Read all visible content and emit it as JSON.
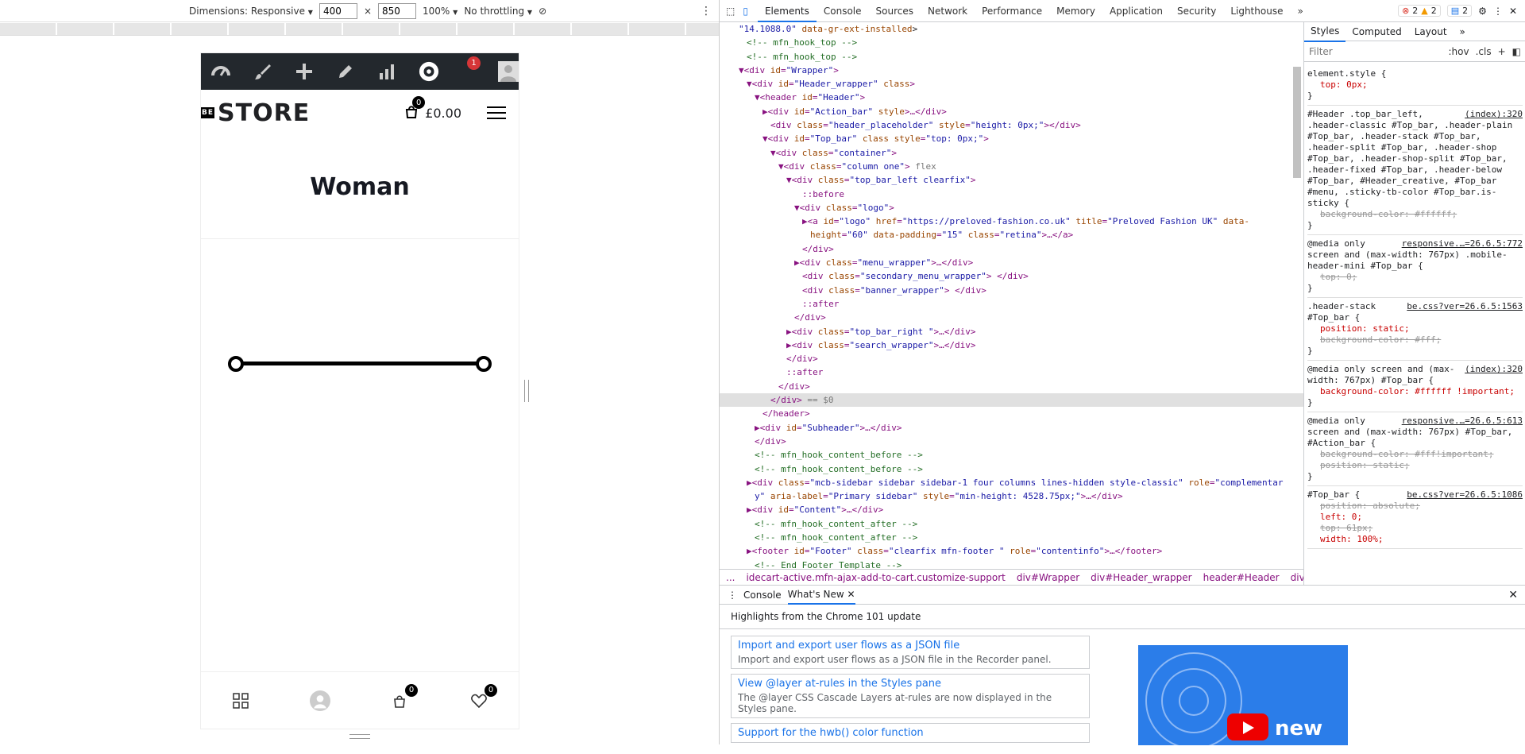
{
  "device_toolbar": {
    "dimensions_label": "Dimensions: Responsive",
    "width": "400",
    "times": "×",
    "height": "850",
    "zoom": "100%",
    "throttling": "No throttling"
  },
  "site": {
    "admin_badge": "1",
    "logo_be": "BE",
    "logo_text": "STORE",
    "cart_count": "0",
    "cart_total": "£0.00",
    "page_title": "Woman",
    "bottom_cart_count": "0",
    "bottom_wishlist_count": "0"
  },
  "devtools": {
    "tabs": [
      "Elements",
      "Console",
      "Sources",
      "Network",
      "Performance",
      "Memory",
      "Application",
      "Security",
      "Lighthouse"
    ],
    "more_tabs": "»",
    "errors": "2",
    "warnings": "2",
    "messages": "2",
    "dom_lines": [
      {
        "indent": 2,
        "html": "<span class='av'>\"14.1088.0\"</span> <span class='at'>data-gr-ext-installed</span><span class='tx'>&gt;</span>"
      },
      {
        "indent": 3,
        "html": "<span class='cm'>&lt;!-- mfn_hook_top --&gt;</span>"
      },
      {
        "indent": 3,
        "html": "<span class='cm'>&lt;!-- mfn_hook_top --&gt;</span>"
      },
      {
        "indent": 2,
        "html": "▼&lt;div <span class='at'>id</span>=<span class='av'>\"Wrapper\"</span>&gt;"
      },
      {
        "indent": 3,
        "html": "▼&lt;div <span class='at'>id</span>=<span class='av'>\"Header_wrapper\"</span> <span class='at'>class</span>&gt;"
      },
      {
        "indent": 4,
        "html": "▼&lt;header <span class='at'>id</span>=<span class='av'>\"Header\"</span>&gt;"
      },
      {
        "indent": 5,
        "html": "▶&lt;div <span class='at'>id</span>=<span class='av'>\"Action_bar\"</span> <span class='at'>style</span>&gt;…&lt;/div&gt;"
      },
      {
        "indent": 6,
        "html": "&lt;div <span class='at'>class</span>=<span class='av'>\"header_placeholder\"</span> <span class='at'>style</span>=<span class='av'>\"height: 0px;\"</span>&gt;&lt;/div&gt;"
      },
      {
        "indent": 5,
        "html": "▼&lt;div <span class='at'>id</span>=<span class='av'>\"Top_bar\"</span> <span class='at'>class</span> <span class='at'>style</span>=<span class='av'>\"top: 0px;\"</span>&gt;"
      },
      {
        "indent": 6,
        "html": "▼&lt;div <span class='at'>class</span>=<span class='av'>\"container\"</span>&gt;"
      },
      {
        "indent": 7,
        "html": "▼&lt;div <span class='at'>class</span>=<span class='av'>\"column one\"</span>&gt; <span class='gy'>flex</span>"
      },
      {
        "indent": 8,
        "html": "▼&lt;div <span class='at'>class</span>=<span class='av'>\"top_bar_left clearfix\"</span>&gt;"
      },
      {
        "indent": 10,
        "html": "::before"
      },
      {
        "indent": 9,
        "html": "▼&lt;div <span class='at'>class</span>=<span class='av'>\"logo\"</span>&gt;"
      },
      {
        "indent": 10,
        "html": "▶&lt;a <span class='at'>id</span>=<span class='av'>\"logo\"</span> <span class='at'>href</span>=<span class='av'>\"https://preloved-fashion.co.uk\"</span> <span class='at'>title</span>=<span class='av'>\"Preloved Fashion UK\"</span> <span class='at'>data-</span>"
      },
      {
        "indent": 11,
        "html": "<span class='at'>height</span>=<span class='av'>\"60\"</span> <span class='at'>data-padding</span>=<span class='av'>\"15\"</span> <span class='at'>class</span>=<span class='av'>\"retina\"</span>&gt;…&lt;/a&gt;"
      },
      {
        "indent": 10,
        "html": "&lt;/div&gt;"
      },
      {
        "indent": 9,
        "html": "▶&lt;div <span class='at'>class</span>=<span class='av'>\"menu_wrapper\"</span>&gt;…&lt;/div&gt;"
      },
      {
        "indent": 10,
        "html": "&lt;div <span class='at'>class</span>=<span class='av'>\"secondary_menu_wrapper\"</span>&gt; &lt;/div&gt;"
      },
      {
        "indent": 10,
        "html": "&lt;div <span class='at'>class</span>=<span class='av'>\"banner_wrapper\"</span>&gt; &lt;/div&gt;"
      },
      {
        "indent": 10,
        "html": "::after"
      },
      {
        "indent": 9,
        "html": "&lt;/div&gt;"
      },
      {
        "indent": 8,
        "html": "▶&lt;div <span class='at'>class</span>=<span class='av'>\"top_bar_right \"</span>&gt;…&lt;/div&gt;"
      },
      {
        "indent": 8,
        "html": "▶&lt;div <span class='at'>class</span>=<span class='av'>\"search_wrapper\"</span>&gt;…&lt;/div&gt;"
      },
      {
        "indent": 8,
        "html": "&lt;/div&gt;"
      },
      {
        "indent": 8,
        "html": "::after"
      },
      {
        "indent": 7,
        "html": "&lt;/div&gt;"
      },
      {
        "indent": 6,
        "html": "&lt;/div&gt; <span class='gy'>== $0</span>",
        "selected": true
      },
      {
        "indent": 5,
        "html": "&lt;/header&gt;"
      },
      {
        "indent": 4,
        "html": "▶&lt;div <span class='at'>id</span>=<span class='av'>\"Subheader\"</span>&gt;…&lt;/div&gt;"
      },
      {
        "indent": 4,
        "html": "&lt;/div&gt;"
      },
      {
        "indent": 4,
        "html": "<span class='cm'>&lt;!-- mfn_hook_content_before --&gt;</span>"
      },
      {
        "indent": 4,
        "html": "<span class='cm'>&lt;!-- mfn_hook_content_before --&gt;</span>"
      },
      {
        "indent": 3,
        "html": "▶&lt;div <span class='at'>class</span>=<span class='av'>\"mcb-sidebar sidebar sidebar-1 four columns lines-hidden style-classic\"</span> <span class='at'>role</span>=<span class='av'>\"complementar</span>"
      },
      {
        "indent": 4,
        "html": "<span class='av'>y\"</span> <span class='at'>aria-label</span>=<span class='av'>\"Primary sidebar\"</span> <span class='at'>style</span>=<span class='av'>\"min-height: 4528.75px;\"</span>&gt;…&lt;/div&gt;"
      },
      {
        "indent": 3,
        "html": "▶&lt;div <span class='at'>id</span>=<span class='av'>\"Content\"</span>&gt;…&lt;/div&gt;"
      },
      {
        "indent": 4,
        "html": "<span class='cm'>&lt;!-- mfn_hook_content_after --&gt;</span>"
      },
      {
        "indent": 4,
        "html": "<span class='cm'>&lt;!-- mfn_hook_content_after --&gt;</span>"
      },
      {
        "indent": 3,
        "html": "▶&lt;footer <span class='at'>id</span>=<span class='av'>\"Footer\"</span> <span class='at'>class</span>=<span class='av'>\"clearfix mfn-footer \"</span> <span class='at'>role</span>=<span class='av'>\"contentinfo\"</span>&gt;…&lt;/footer&gt;"
      },
      {
        "indent": 4,
        "html": "<span class='cm'>&lt;!-- End Footer Template --&gt;</span>"
      }
    ],
    "breadcrumbs": [
      "...",
      "idecart-active.mfn-ajax-add-to-cart.customize-support",
      "div#Wrapper",
      "div#Header_wrapper",
      "header#Header",
      "div#Top_bar",
      "..."
    ],
    "styles_tabs": [
      "Styles",
      "Computed",
      "Layout",
      "»"
    ],
    "filter_placeholder": "Filter",
    "hov": ":hov",
    "cls": ".cls",
    "rules": [
      {
        "selector": "element.style {",
        "source": "",
        "props": [
          {
            "t": "top: 0px;",
            "strike": false
          }
        ],
        "close": "}"
      },
      {
        "selector": "#Header .top_bar_left, .header-classic #Top_bar, .header-plain #Top_bar, .header-stack #Top_bar, .header-split #Top_bar, .header-shop #Top_bar, .header-shop-split #Top_bar, .header-fixed #Top_bar, .header-below #Top_bar, #Header_creative, #Top_bar #menu, .sticky-tb-color #Top_bar.is-sticky {",
        "source": "(index):320",
        "props": [
          {
            "t": "background-color: #ffffff;",
            "strike": true
          }
        ],
        "close": "}"
      },
      {
        "selector": "@media only screen and (max-width: 767px) .mobile-header-mini #Top_bar {",
        "source": "responsive.…=26.6.5:772",
        "props": [
          {
            "t": "top: 0;",
            "strike": true
          }
        ],
        "close": "}"
      },
      {
        "selector": ".header-stack #Top_bar {",
        "source": "be.css?ver=26.6.5:1563",
        "props": [
          {
            "t": "position: static;",
            "strike": false
          },
          {
            "t": "background-color: #fff;",
            "strike": true
          }
        ],
        "close": "}"
      },
      {
        "selector": "@media only screen and (max-width: 767px) #Top_bar {",
        "source": "(index):320",
        "props": [
          {
            "t": "background-color: #ffffff !important;",
            "strike": false
          }
        ],
        "close": "}"
      },
      {
        "selector": "@media only screen and (max-width: 767px) #Top_bar, #Action_bar {",
        "source": "responsive.…=26.6.5:613",
        "props": [
          {
            "t": "background-color: #fff!important;",
            "strike": true
          },
          {
            "t": "position: static;",
            "strike": true
          }
        ],
        "close": "}"
      },
      {
        "selector": "#Top_bar {",
        "source": "be.css?ver=26.6.5:1086",
        "props": [
          {
            "t": "position: absolute;",
            "strike": true
          },
          {
            "t": "left: 0;",
            "strike": false
          },
          {
            "t": "top: 61px;",
            "strike": true
          },
          {
            "t": "width: 100%;",
            "strike": false
          }
        ],
        "close": ""
      }
    ],
    "drawer_tabs": [
      "Console",
      "What's New"
    ],
    "highlights": "Highlights from the Chrome 101 update",
    "cards": [
      {
        "title": "Import and export user flows as a JSON file",
        "desc": "Import and export user flows as a JSON file in the Recorder panel."
      },
      {
        "title": "View @layer at-rules in the Styles pane",
        "desc": "The @layer CSS Cascade Layers at-rules are now displayed in the Styles pane."
      },
      {
        "title": "Support for the hwb() color function",
        "desc": ""
      }
    ],
    "promo_text": "new"
  },
  "colors": {
    "admin_bar": "#23282d",
    "devtools_accent": "#1a73e8",
    "badge_red": "#d63638"
  }
}
